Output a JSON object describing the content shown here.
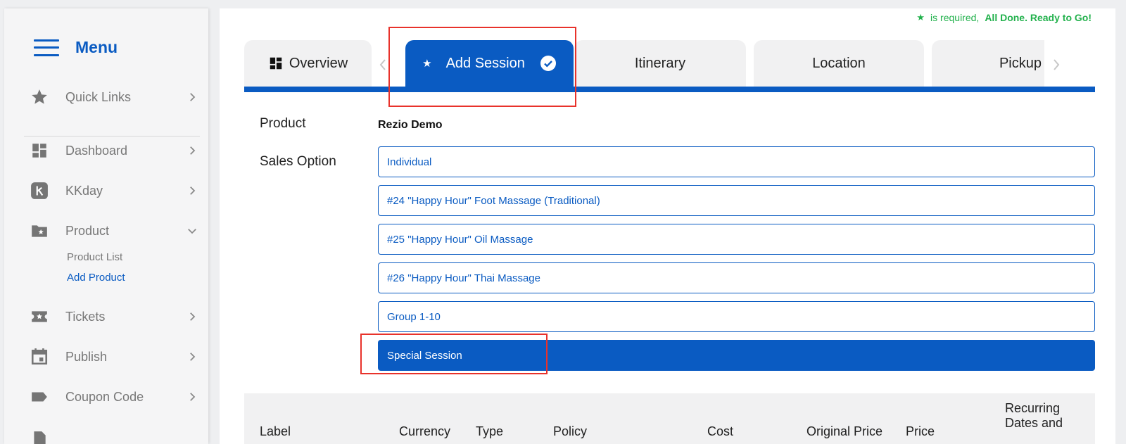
{
  "sidebar": {
    "menu_title": "Menu",
    "items": [
      {
        "label": "Quick Links",
        "icon": "star-icon"
      },
      {
        "label": "Dashboard",
        "icon": "dashboard-icon"
      },
      {
        "label": "KKday",
        "icon": "kkday-icon"
      },
      {
        "label": "Product",
        "icon": "folder-star-icon",
        "expanded": true
      },
      {
        "label": "Tickets",
        "icon": "ticket-icon"
      },
      {
        "label": "Publish",
        "icon": "calendar-icon"
      },
      {
        "label": "Coupon Code",
        "icon": "tag-icon"
      }
    ],
    "product_sub": [
      "Product List",
      "Add Product"
    ],
    "active_sub": "Add Product"
  },
  "header": {
    "required_prefix": "is required,",
    "done_text": "All Done. Ready to Go!"
  },
  "tabs": [
    {
      "label": "Overview"
    },
    {
      "label": "Add Session",
      "active": true
    },
    {
      "label": "Itinerary"
    },
    {
      "label": "Location"
    },
    {
      "label": "Pickup"
    }
  ],
  "form": {
    "product_label": "Product",
    "product_value": "Rezio Demo",
    "sales_option_label": "Sales Option",
    "options": [
      "Individual",
      "#24 \"Happy Hour\" Foot Massage (Traditional)",
      "#25 \"Happy Hour\" Oil Massage",
      "#26 \"Happy Hour\" Thai Massage",
      "Group 1-10",
      "Special Session"
    ],
    "selected_option": "Special Session"
  },
  "table": {
    "headers": [
      "Label",
      "Currency",
      "Type",
      "Policy",
      "Cost",
      "Original Price",
      "Price",
      "Recurring Dates and"
    ]
  },
  "colors": {
    "accent": "#0a5bc2",
    "success": "#22b14c",
    "highlight": "#e8322b"
  }
}
